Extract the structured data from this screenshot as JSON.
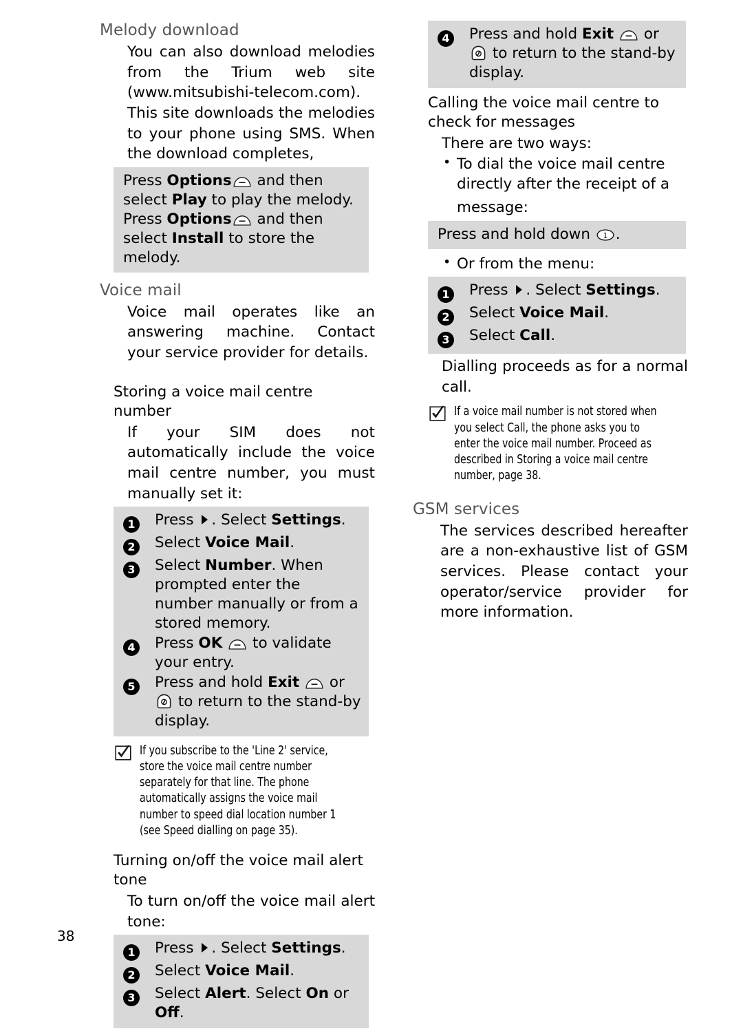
{
  "page": {
    "number": "38"
  },
  "left_column": {
    "melody": {
      "heading": "Melody download",
      "body": "You can also download melodies from the Trium web site (www.mitsubishi-telecom.com). This site downloads the melodies to your phone using SMS. When the download completes,",
      "box_lines": [
        {
          "pre": "Press ",
          "bold1": "Options",
          "icon": "softkey-icon",
          "mid": " and then select ",
          "bold2": "Play",
          "post": " to play the melody."
        },
        {
          "pre": "Press ",
          "bold1": "Options",
          "icon": "softkey-icon",
          "mid": " and then select ",
          "bold2": "Install",
          "post": " to store the melody."
        }
      ]
    },
    "voicemail": {
      "heading": "Voice mail",
      "intro": "Voice mail operates like an answering machine. Contact your service provider for details.",
      "storing": {
        "heading": "Storing a voice mail centre number",
        "body": "If your SIM does not automatically include the voice mail centre number, you must manually set it:",
        "steps": [
          {
            "num": "1",
            "segments": [
              {
                "t": "Press "
              },
              {
                "icon": "nav-right-icon"
              },
              {
                "t": ". Select "
              },
              {
                "t": "Settings",
                "b": true
              },
              {
                "t": "."
              }
            ]
          },
          {
            "num": "2",
            "segments": [
              {
                "t": "Select "
              },
              {
                "t": "Voice Mail",
                "b": true
              },
              {
                "t": "."
              }
            ]
          },
          {
            "num": "3",
            "segments": [
              {
                "t": "Select "
              },
              {
                "t": "Number",
                "b": true
              },
              {
                "t": ". When prompted enter the number manually or from a stored memory."
              }
            ]
          },
          {
            "num": "4",
            "segments": [
              {
                "t": "Press "
              },
              {
                "t": "OK",
                "b": true
              },
              {
                "t": " "
              },
              {
                "icon": "softkey-icon"
              },
              {
                "t": " to validate your entry."
              }
            ]
          },
          {
            "num": "5",
            "segments": [
              {
                "t": "Press and hold "
              },
              {
                "t": "Exit",
                "b": true
              },
              {
                "t": " "
              },
              {
                "icon": "softkey-icon"
              },
              {
                "t": " or "
              },
              {
                "icon": "hangup-key-icon"
              },
              {
                "t": " to return to the stand-by display."
              }
            ]
          }
        ],
        "note": "If you subscribe to the 'Line 2' service, store the voice mail centre number separately for that line. The phone automatically assigns the voice mail number to speed dial location number 1 (see Speed dialling on page 35)."
      },
      "alert_tone": {
        "heading": "Turning on/off the voice mail alert tone",
        "body": "To turn on/off the voice mail alert tone:",
        "steps": [
          {
            "num": "1",
            "segments": [
              {
                "t": "Press "
              },
              {
                "icon": "nav-right-icon"
              },
              {
                "t": ". Select "
              },
              {
                "t": "Settings",
                "b": true
              },
              {
                "t": "."
              }
            ]
          },
          {
            "num": "2",
            "segments": [
              {
                "t": "Select "
              },
              {
                "t": "Voice Mail",
                "b": true
              },
              {
                "t": "."
              }
            ]
          },
          {
            "num": "3",
            "segments": [
              {
                "t": "Select "
              },
              {
                "t": "Alert",
                "b": true
              },
              {
                "t": ". Select "
              },
              {
                "t": "On",
                "b": true
              },
              {
                "t": " or "
              },
              {
                "t": "Off",
                "b": true
              },
              {
                "t": "."
              }
            ]
          }
        ]
      }
    }
  },
  "right_column": {
    "continued_step": {
      "num": "4",
      "segments": [
        {
          "t": "Press and hold "
        },
        {
          "t": "Exit",
          "b": true
        },
        {
          "t": " "
        },
        {
          "icon": "softkey-icon"
        },
        {
          "t": " or "
        },
        {
          "icon": "hangup-key-icon"
        },
        {
          "t": " to return to the stand-by display."
        }
      ]
    },
    "calling": {
      "heading": "Calling the voice mail centre to check for messages",
      "intro": "There are two ways:",
      "bullet1": "To dial the voice mail centre directly after the receipt of a",
      "bullet1_cont": "message:",
      "box1_segments": [
        {
          "t": "Press and hold down "
        },
        {
          "icon": "key-1-icon"
        },
        {
          "t": "."
        }
      ],
      "bullet2": "Or from the menu:",
      "steps": [
        {
          "num": "1",
          "segments": [
            {
              "t": "Press "
            },
            {
              "icon": "nav-right-icon"
            },
            {
              "t": ". Select "
            },
            {
              "t": "Settings",
              "b": true
            },
            {
              "t": "."
            }
          ]
        },
        {
          "num": "2",
          "segments": [
            {
              "t": "Select "
            },
            {
              "t": "Voice Mail",
              "b": true
            },
            {
              "t": "."
            }
          ]
        },
        {
          "num": "3",
          "segments": [
            {
              "t": "Select "
            },
            {
              "t": "Call",
              "b": true
            },
            {
              "t": "."
            }
          ]
        }
      ],
      "after": "Dialling proceeds as for a normal call.",
      "note": "If a voice mail number is not stored when you select Call, the phone asks you to enter the voice mail number. Proceed as described in Storing a voice mail centre number, page 38."
    },
    "gsm": {
      "heading": "GSM services",
      "body": "The services described hereafter are a non-exhaustive list of GSM services. Please contact your operator/service provider for more information."
    }
  },
  "colors": {
    "heading_grey": "#575757",
    "box_grey": "#d8d8d8",
    "text_black": "#000000"
  }
}
